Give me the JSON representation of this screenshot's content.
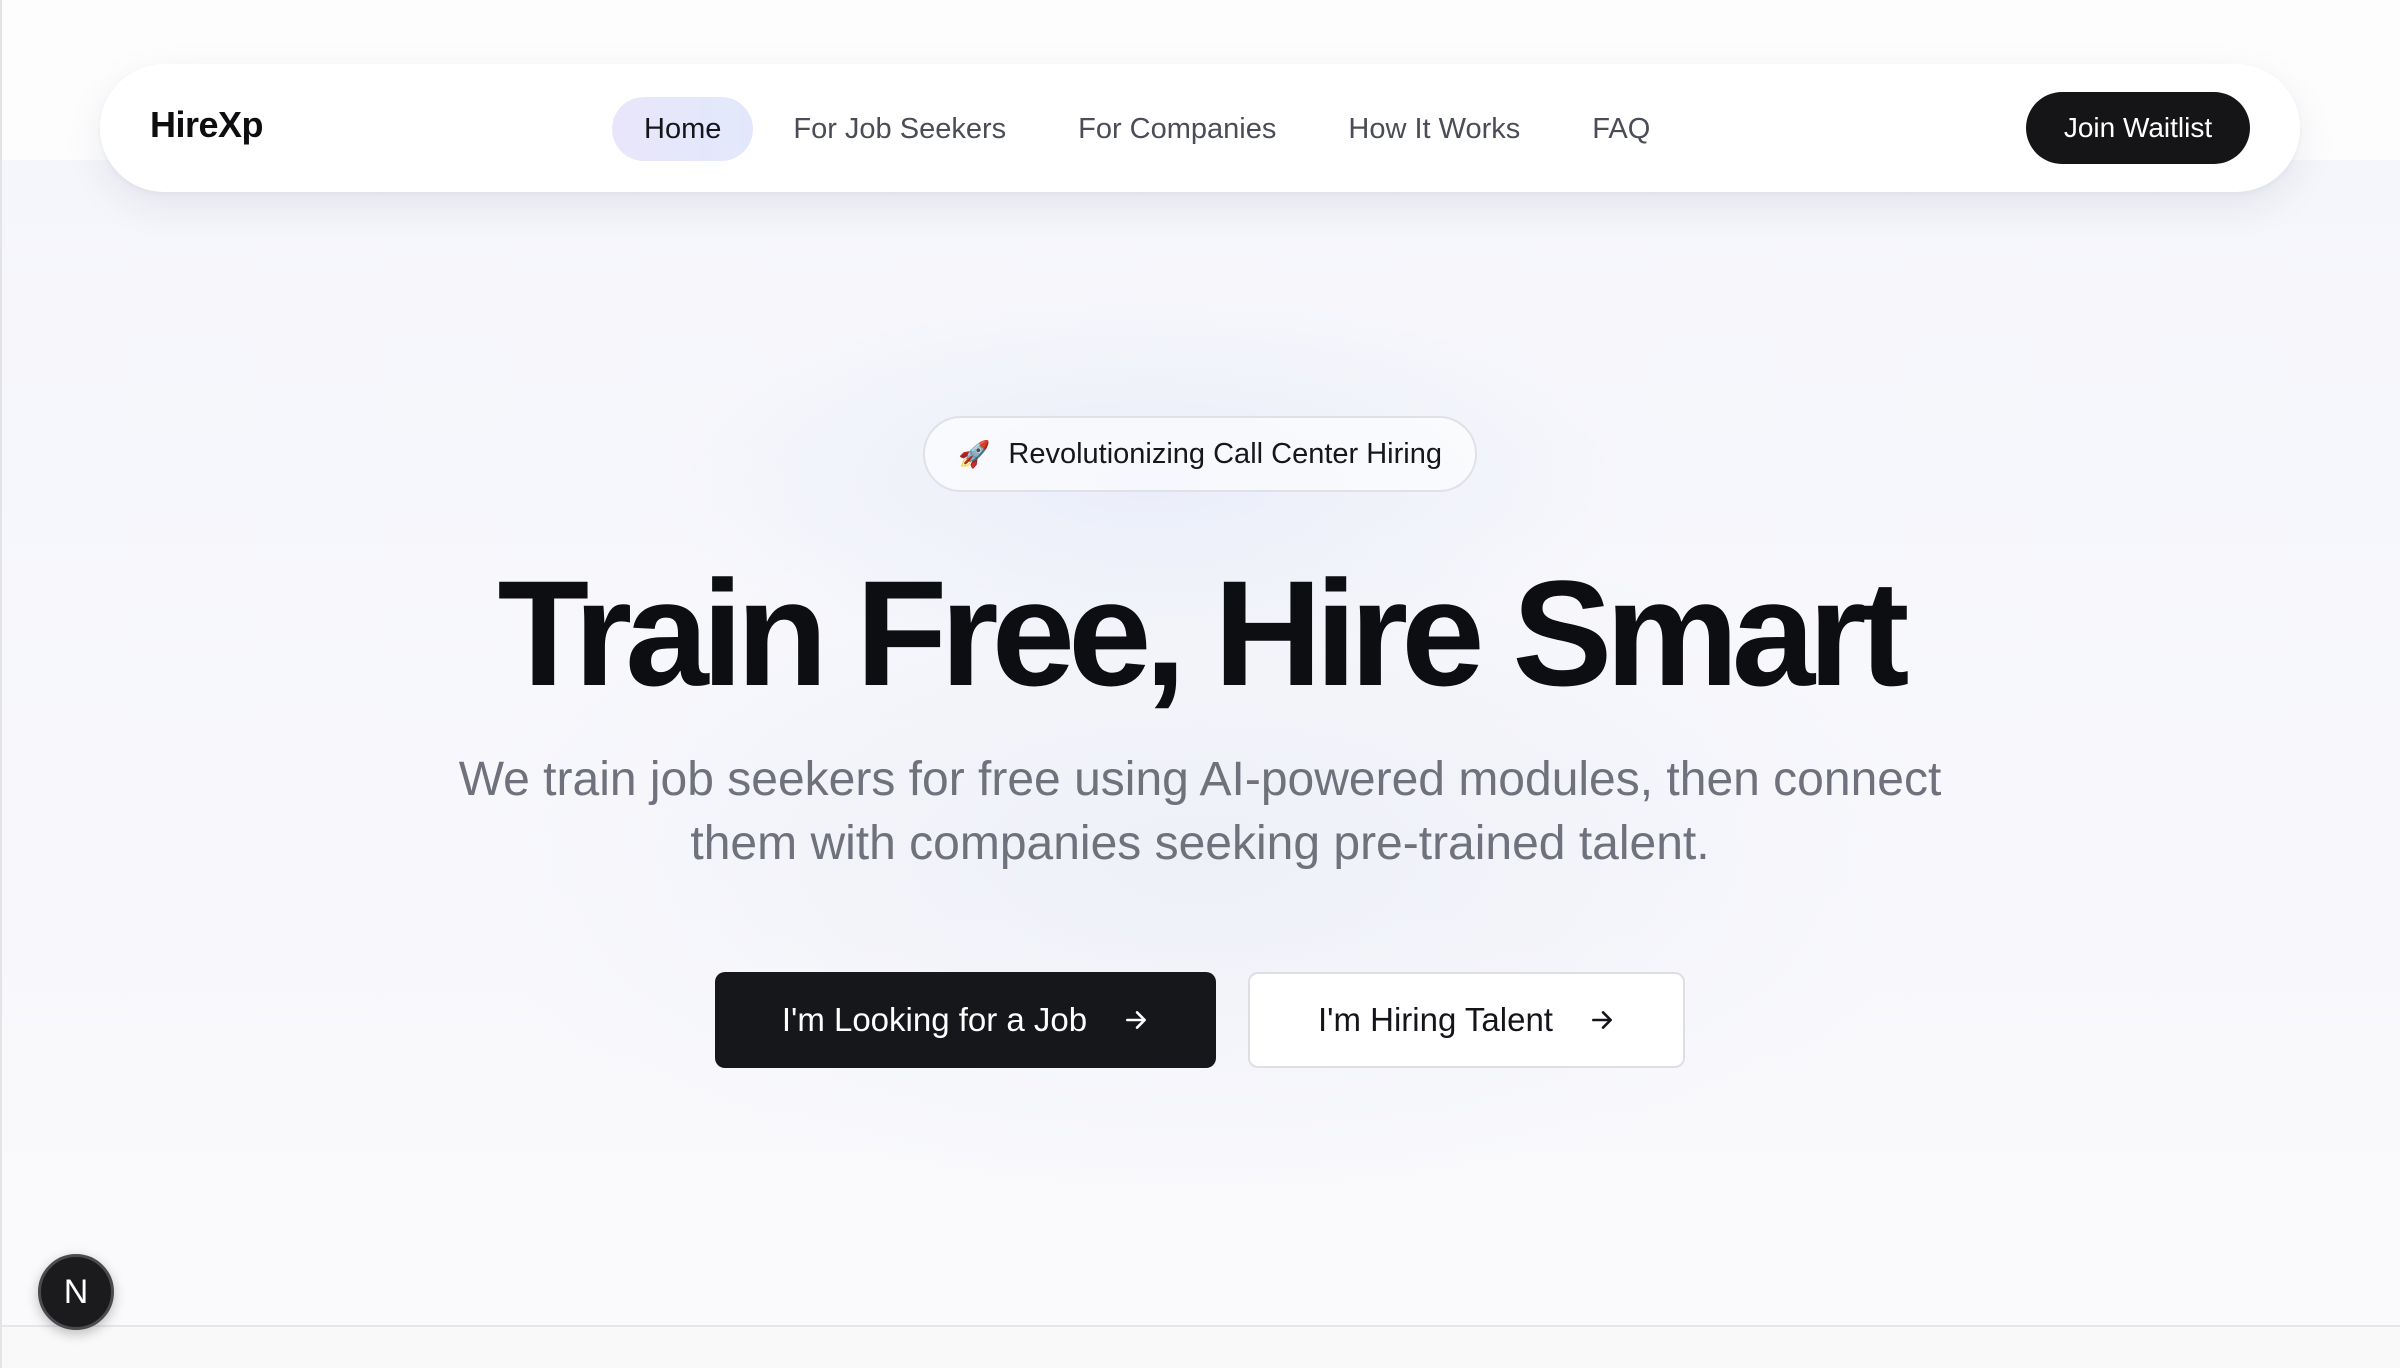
{
  "nav": {
    "brand": "HireXp",
    "links": [
      "Home",
      "For Job Seekers",
      "For Companies",
      "How It Works",
      "FAQ"
    ],
    "active": "Home",
    "cta": "Join Waitlist"
  },
  "hero": {
    "badge_icon": "rocket-icon",
    "badge_emoji": "🚀",
    "badge_text": "Revolutionizing Call Center Hiring",
    "title": "Train Free, Hire Smart",
    "subtitle": "We train job seekers for free using AI-powered modules, then connect them with companies seeking pre-trained talent.",
    "primary_cta": "I'm Looking for a Job",
    "secondary_cta": "I'm Hiring Talent"
  },
  "dev_badge": {
    "icon": "nextjs-icon",
    "letter": "N"
  },
  "colors": {
    "primary_dark": "#16171b",
    "active_nav_bg": "#e6e7fb",
    "muted_text": "#6f727c"
  }
}
